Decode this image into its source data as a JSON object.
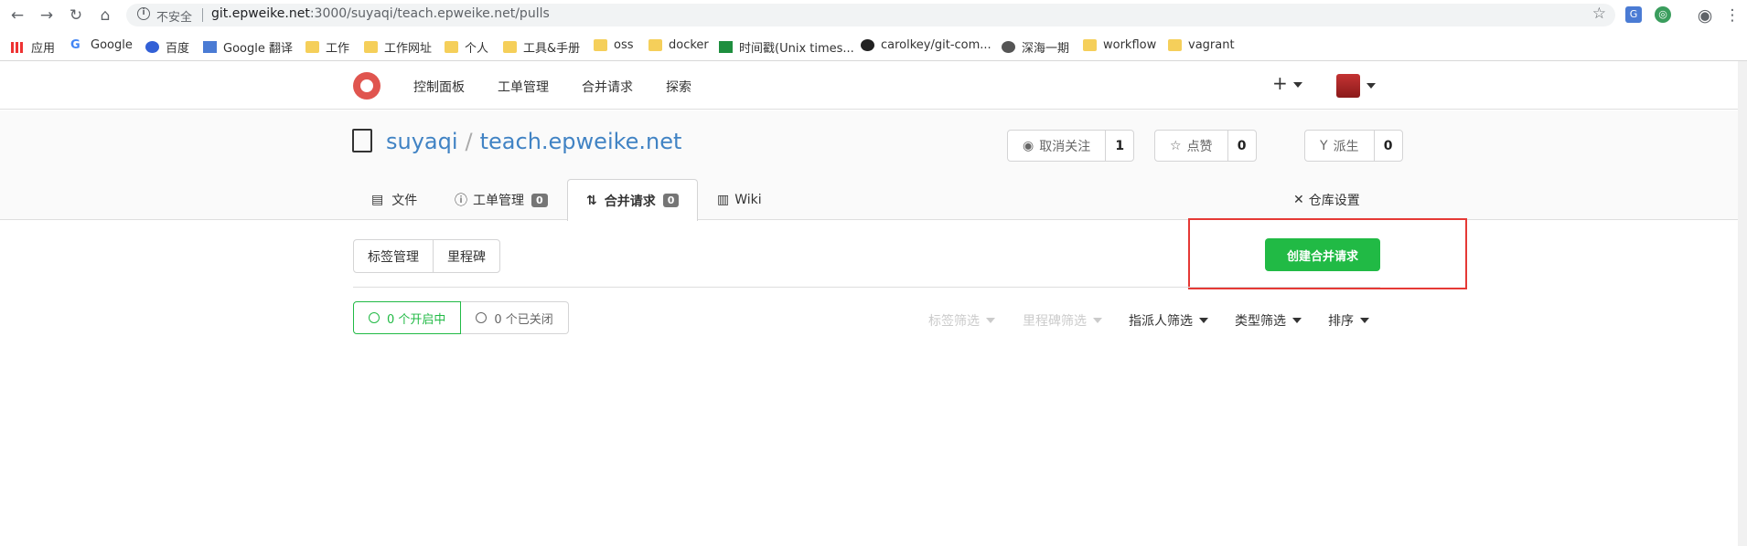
{
  "browser": {
    "insecure_label": "不安全",
    "url_host": "git.epweike.net",
    "url_path": ":3000/suyaqi/teach.epweike.net/pulls"
  },
  "bookmarks": [
    {
      "label": "应用",
      "icon": "apps-icon"
    },
    {
      "label": "Google",
      "icon": "google-icon"
    },
    {
      "label": "百度",
      "icon": "baidu-icon"
    },
    {
      "label": "Google 翻译",
      "icon": "translate-icon"
    },
    {
      "label": "工作",
      "icon": "folder-icon"
    },
    {
      "label": "工作网址",
      "icon": "folder-icon"
    },
    {
      "label": "个人",
      "icon": "folder-icon"
    },
    {
      "label": "工具&手册",
      "icon": "folder-icon"
    },
    {
      "label": "oss",
      "icon": "folder-icon"
    },
    {
      "label": "docker",
      "icon": "folder-icon"
    },
    {
      "label": "时间戳(Unix times...",
      "icon": "sheet-icon"
    },
    {
      "label": "carolkey/git-com...",
      "icon": "github-icon"
    },
    {
      "label": "深海一期",
      "icon": "globe-icon"
    },
    {
      "label": "workflow",
      "icon": "folder-icon"
    },
    {
      "label": "vagrant",
      "icon": "folder-icon"
    }
  ],
  "nav": {
    "dashboard": "控制面板",
    "issues": "工单管理",
    "pulls": "合并请求",
    "explore": "探索"
  },
  "repo": {
    "owner": "suyaqi",
    "separator": "/",
    "name": "teach.epweike.net",
    "unwatch_label": "取消关注",
    "watch_count": "1",
    "star_label": "点赞",
    "star_count": "0",
    "fork_label": "派生",
    "fork_count": "0"
  },
  "tabs": {
    "files": "文件",
    "issues": "工单管理",
    "issues_count": "0",
    "pulls": "合并请求",
    "pulls_count": "0",
    "wiki": "Wiki",
    "settings": "仓库设置"
  },
  "toolbar": {
    "labels": "标签管理",
    "milestones": "里程碑",
    "create_pr": "创建合并请求"
  },
  "states": {
    "open": "0 个开启中",
    "closed": "0 个已关闭"
  },
  "filters": {
    "label": "标签筛选",
    "milestone": "里程碑筛选",
    "assignee": "指派人筛选",
    "type": "类型筛选",
    "sort": "排序"
  }
}
